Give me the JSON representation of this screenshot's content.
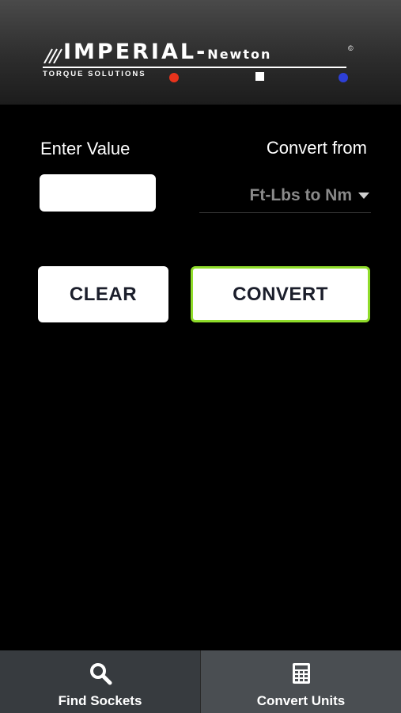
{
  "header": {
    "logo_title": "IMPERIAL-",
    "logo_subtitle": "Newton",
    "logo_tagline": "TORQUE SOLUTIONS",
    "logo_copyright": "©"
  },
  "form": {
    "enter_value_label": "Enter Value",
    "value_input": "",
    "convert_from_label": "Convert from",
    "conversion_selected": "Ft-Lbs to Nm"
  },
  "buttons": {
    "clear_label": "CLEAR",
    "convert_label": "CONVERT"
  },
  "tabs": [
    {
      "label": "Find Sockets",
      "icon": "search-icon"
    },
    {
      "label": "Convert Units",
      "icon": "calculator-icon"
    }
  ],
  "colors": {
    "convert_border": "#8fdc2a",
    "logo_red": "#e8331c",
    "logo_blue": "#2d3fd6"
  }
}
